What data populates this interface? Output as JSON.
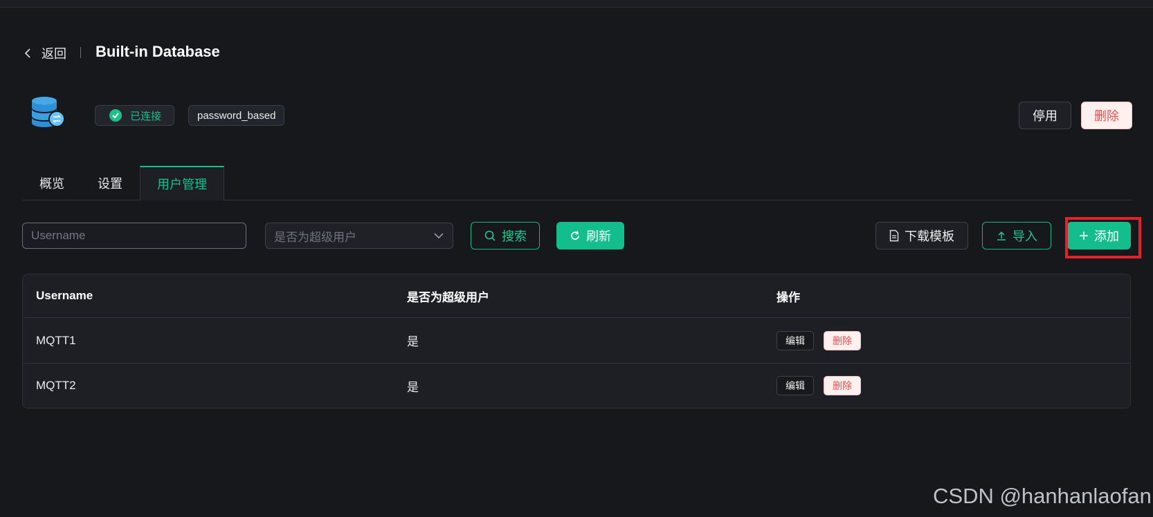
{
  "header": {
    "back_label": "返回",
    "title": "Built-in Database"
  },
  "info": {
    "status": "已连接",
    "type": "password_based",
    "disable_label": "停用",
    "delete_label": "删除"
  },
  "tabs": [
    {
      "label": "概览"
    },
    {
      "label": "设置"
    },
    {
      "label": "用户管理",
      "active": true
    }
  ],
  "toolbar": {
    "username_placeholder": "Username",
    "superuser_placeholder": "是否为超级用户",
    "search_label": "搜索",
    "refresh_label": "刷新",
    "template_label": "下载模板",
    "import_label": "导入",
    "add_label": "添加"
  },
  "table": {
    "columns": [
      "Username",
      "是否为超级用户",
      "操作"
    ],
    "rows": [
      {
        "username": "MQTT1",
        "superuser": "是",
        "edit": "编辑",
        "delete": "删除"
      },
      {
        "username": "MQTT2",
        "superuser": "是",
        "edit": "编辑",
        "delete": "删除"
      }
    ]
  },
  "colors": {
    "accent": "#13be8c",
    "danger": "#e0504e",
    "background": "#17181c",
    "highlight": "#e4212a"
  },
  "watermark": "CSDN @hanhanlaofan"
}
